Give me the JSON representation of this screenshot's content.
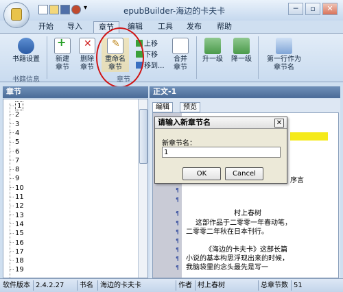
{
  "window": {
    "title": "epubBuilder-海边的卡夫卡",
    "minimize": "─",
    "restore": "▫",
    "close": "✕"
  },
  "tabs": [
    "开始",
    "导入",
    "章节",
    "编辑",
    "工具",
    "发布",
    "帮助"
  ],
  "ribbon": {
    "book_settings": "书籍设置",
    "book_info_group": "书籍信息",
    "new_chapter": [
      "新建",
      "章节"
    ],
    "delete_chapter": [
      "删除",
      "章节"
    ],
    "rename_chapter": [
      "重命名",
      "章节"
    ],
    "move_up": "上移",
    "move_down": "下移",
    "move_to": "移到...",
    "merge_chapter": [
      "合并",
      "章节"
    ],
    "chapter_group": "章节",
    "level_up": "升一级",
    "level_down": "降一级",
    "first_line_name": [
      "第一行作为",
      "章节名"
    ]
  },
  "left_panel": {
    "header": "章节",
    "items": [
      "1",
      "2",
      "3",
      "4",
      "5",
      "6",
      "7",
      "8",
      "9",
      "10",
      "11",
      "12",
      "13",
      "14",
      "15",
      "16",
      "17",
      "18",
      "19"
    ]
  },
  "right_panel": {
    "header": "正文-1",
    "tab_edit": "编辑",
    "tab_preview": "预览",
    "lines": [
      "序言",
      "村上春树",
      "这部作品于二零零一年春动笔，",
      "二零零二年秋在日本刊行。",
      "《海边的卡夫卡》这部长篇",
      "小说的基本构思浮现出来的时候，",
      "我脑袋里的念头最先是写一"
    ]
  },
  "dialog": {
    "title": "请输入新章节名",
    "close": "✕",
    "label": "新章节名：",
    "input_value": "1",
    "ok": "OK",
    "cancel": "Cancel"
  },
  "status": {
    "version_label": "软件版本",
    "version": "2.4.2.27",
    "book_label": "书名",
    "book": "海边的卡夫卡",
    "author_label": "作者",
    "author": "村上春树",
    "chapters_label": "总章节数",
    "chapters": "51"
  },
  "colors": {
    "annotation_circle": "#d01515",
    "highlight": "#f5ea1a"
  }
}
